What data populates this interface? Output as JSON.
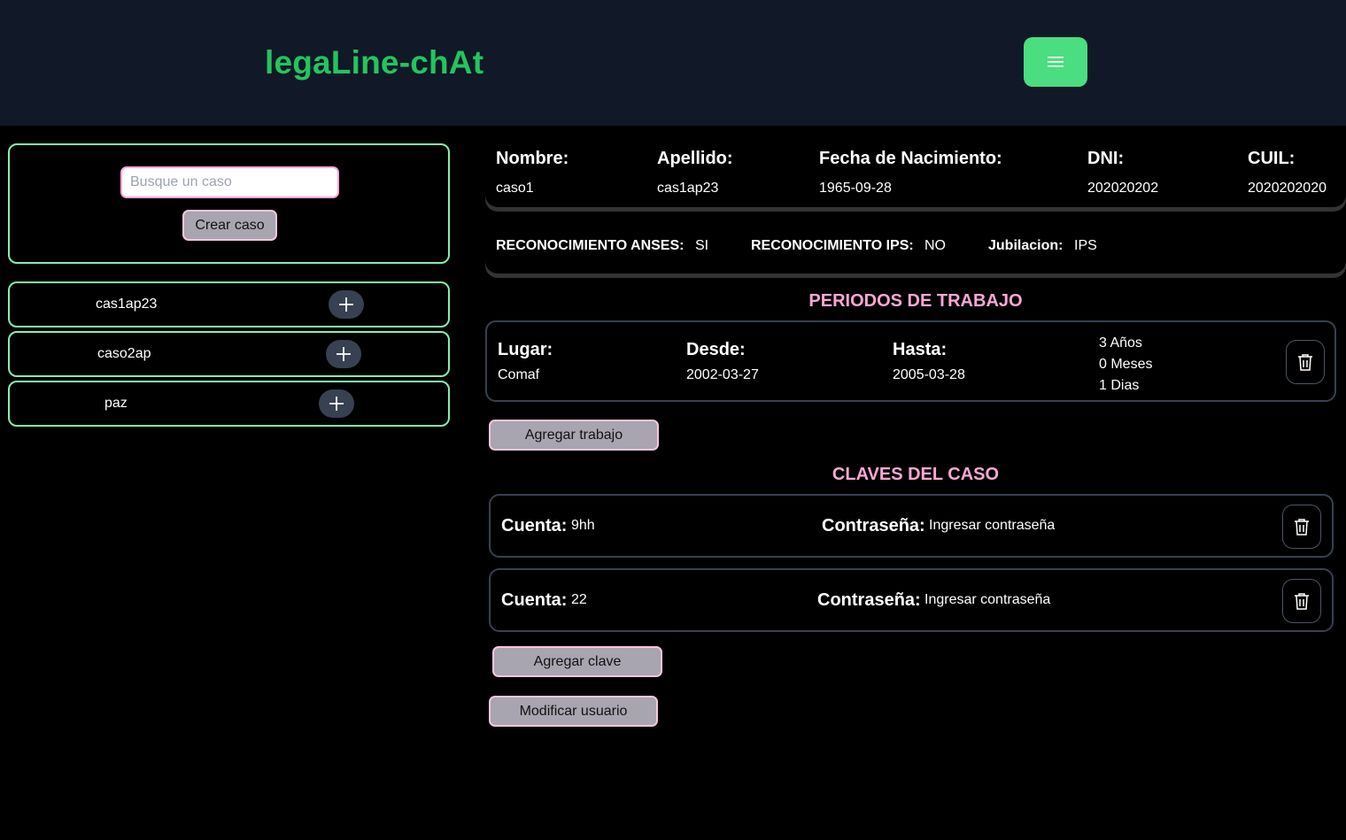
{
  "header": {
    "brand": "legaLine-chAt",
    "menu_icon": "hamburger-menu-icon"
  },
  "sidebar": {
    "search_placeholder": "Busque un caso",
    "create_label": "Crear caso",
    "cases": [
      {
        "label": "cas1ap23"
      },
      {
        "label": "caso2ap"
      },
      {
        "label": "paz"
      }
    ]
  },
  "profile": {
    "fields": [
      {
        "label": "Nombre:",
        "value": "caso1"
      },
      {
        "label": "Apellido:",
        "value": "cas1ap23"
      },
      {
        "label": "Fecha de Nacimiento:",
        "value": "1965-09-28"
      },
      {
        "label": "DNI:",
        "value": "202020202"
      },
      {
        "label": "CUIL:",
        "value": "2020202020"
      }
    ],
    "recognition": [
      {
        "label": "RECONOCIMIENTO ANSES:",
        "value": "SI"
      },
      {
        "label": "RECONOCIMIENTO IPS:",
        "value": "NO"
      },
      {
        "label": "Jubilacion:",
        "value": "IPS"
      }
    ]
  },
  "work_section": {
    "title": "PERIODOS DE TRABAJO",
    "periods": [
      {
        "lugar_label": "Lugar:",
        "lugar": "Comaf",
        "desde_label": "Desde:",
        "desde": "2002-03-27",
        "hasta_label": "Hasta:",
        "hasta": "2005-03-28",
        "years": "3 Años",
        "months": "0 Meses",
        "days": "1 Dias"
      }
    ],
    "add_label": "Agregar trabajo"
  },
  "keys_section": {
    "title": "CLAVES DEL CASO",
    "keys": [
      {
        "account_label": "Cuenta:",
        "account": "9hh",
        "password_label": "Contraseña:",
        "password": "Ingresar contraseña"
      },
      {
        "account_label": "Cuenta:",
        "account": "22",
        "password_label": "Contraseña:",
        "password": "Ingresar contraseña"
      }
    ],
    "add_label": "Agregar clave"
  },
  "modify_label": "Modificar usuario",
  "colors": {
    "topbar": "#111827",
    "brand": "#22c55e",
    "menu_button": "#4ade80",
    "section_title": "#f9a8d4",
    "case_border": "#86efac"
  }
}
